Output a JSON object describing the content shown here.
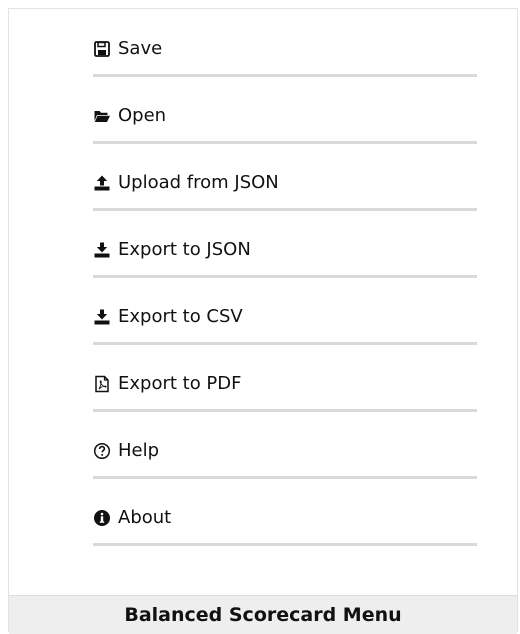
{
  "menu": {
    "items": [
      {
        "label": "Save",
        "icon": "floppy-disk-icon"
      },
      {
        "label": "Open",
        "icon": "folder-open-icon"
      },
      {
        "label": "Upload from JSON",
        "icon": "upload-icon"
      },
      {
        "label": "Export to JSON",
        "icon": "download-icon"
      },
      {
        "label": "Export to CSV",
        "icon": "download-icon"
      },
      {
        "label": "Export to PDF",
        "icon": "pdf-file-icon"
      },
      {
        "label": "Help",
        "icon": "question-circle-icon"
      },
      {
        "label": "About",
        "icon": "info-circle-icon"
      }
    ],
    "footer_title": "Balanced Scorecard Menu"
  },
  "colors": {
    "text": "#111111",
    "divider": "#d9d9d9",
    "footer_background": "#eeeeee"
  }
}
